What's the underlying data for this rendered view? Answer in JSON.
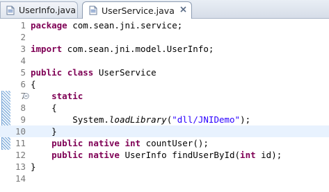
{
  "tabs": [
    {
      "label": "UserInfo.java",
      "icon": "java-file-icon",
      "active": false
    },
    {
      "label": "UserService.java",
      "icon": "java-file-icon",
      "active": true
    }
  ],
  "editor": {
    "current_line": 10,
    "line_numbers": [
      "1",
      "2",
      "3",
      "4",
      "5",
      "6",
      "7",
      "8",
      "9",
      "10",
      "11",
      "12",
      "13",
      "14"
    ],
    "lines": [
      {
        "indent": "",
        "tokens": [
          {
            "t": "package",
            "c": "kw"
          },
          {
            "t": " com.sean.jni.service;",
            "c": ""
          }
        ]
      },
      {
        "indent": "",
        "tokens": []
      },
      {
        "indent": "",
        "tokens": [
          {
            "t": "import",
            "c": "kw"
          },
          {
            "t": " com.sean.jni.model.UserInfo;",
            "c": ""
          }
        ]
      },
      {
        "indent": "",
        "tokens": []
      },
      {
        "indent": "",
        "tokens": [
          {
            "t": "public",
            "c": "kw"
          },
          {
            "t": " ",
            "c": ""
          },
          {
            "t": "class",
            "c": "kw"
          },
          {
            "t": " UserService",
            "c": ""
          }
        ]
      },
      {
        "indent": "",
        "tokens": [
          {
            "t": "{",
            "c": ""
          }
        ]
      },
      {
        "indent": "    ",
        "tokens": [
          {
            "t": "static",
            "c": "kw"
          }
        ]
      },
      {
        "indent": "    ",
        "tokens": [
          {
            "t": "{",
            "c": ""
          }
        ]
      },
      {
        "indent": "        ",
        "tokens": [
          {
            "t": "System.",
            "c": ""
          },
          {
            "t": "loadLibrary",
            "c": "it"
          },
          {
            "t": "(",
            "c": ""
          },
          {
            "t": "\"dll/JNIDemo\"",
            "c": "str"
          },
          {
            "t": ");",
            "c": ""
          }
        ]
      },
      {
        "indent": "    ",
        "tokens": [
          {
            "t": "}",
            "c": ""
          }
        ]
      },
      {
        "indent": "    ",
        "tokens": [
          {
            "t": "public",
            "c": "kw"
          },
          {
            "t": " ",
            "c": ""
          },
          {
            "t": "native",
            "c": "kw"
          },
          {
            "t": " ",
            "c": ""
          },
          {
            "t": "int",
            "c": "kw"
          },
          {
            "t": " countUser();",
            "c": ""
          }
        ]
      },
      {
        "indent": "    ",
        "tokens": [
          {
            "t": "public",
            "c": "kw"
          },
          {
            "t": " ",
            "c": ""
          },
          {
            "t": "native",
            "c": "kw"
          },
          {
            "t": " UserInfo findUserById(",
            "c": ""
          },
          {
            "t": "int",
            "c": "kw"
          },
          {
            "t": " id);",
            "c": ""
          }
        ]
      },
      {
        "indent": "",
        "tokens": [
          {
            "t": "}",
            "c": ""
          }
        ]
      },
      {
        "indent": "",
        "tokens": []
      }
    ],
    "fold_marker_line": 7
  },
  "colors": {
    "keyword": "#7f0055",
    "string": "#2a00ff",
    "current_line_bg": "#e8f2fe",
    "line_number": "#787878"
  }
}
